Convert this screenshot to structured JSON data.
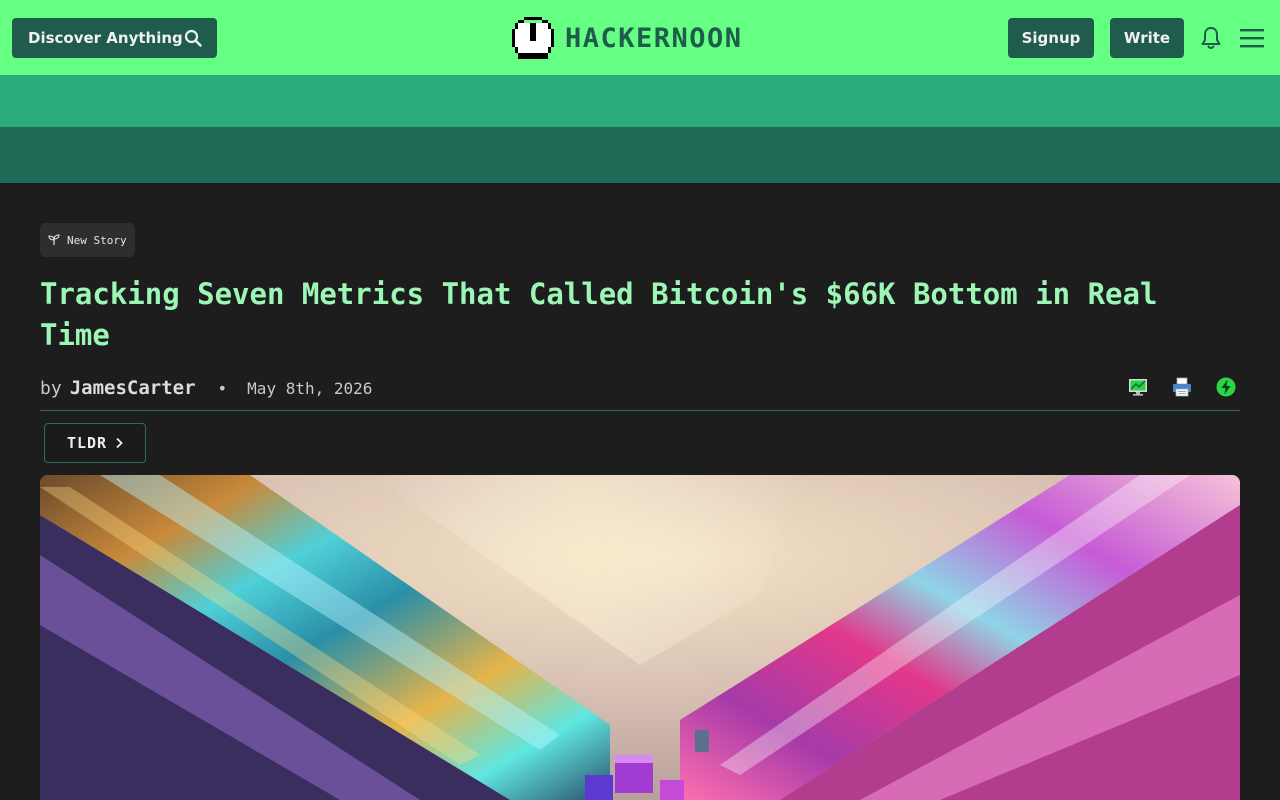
{
  "header": {
    "discover_label": "Discover Anything",
    "logo_text": "HACKERNOON",
    "signup_label": "Signup",
    "write_label": "Write"
  },
  "article": {
    "badge_label": "New Story",
    "title": "Tracking Seven Metrics That Called Bitcoin's $66K Bottom in Real Time",
    "by_label": "by",
    "author": "JamesCarter",
    "separator": "•",
    "date": "May 8th, 2026",
    "tldr_label": "TLDR"
  },
  "colors": {
    "header_bg": "#64ff83",
    "brand_dark": "#1f5c4b",
    "band_light": "#2bac7a",
    "band_dark": "#1e6a56",
    "page_bg": "#1d1d1d",
    "title": "#9cf7b7"
  },
  "icons": [
    "search-icon",
    "bell-icon",
    "menu-icon",
    "sprout-icon",
    "monitor-icon",
    "print-icon",
    "bolt-icon",
    "chevron-right-icon"
  ]
}
